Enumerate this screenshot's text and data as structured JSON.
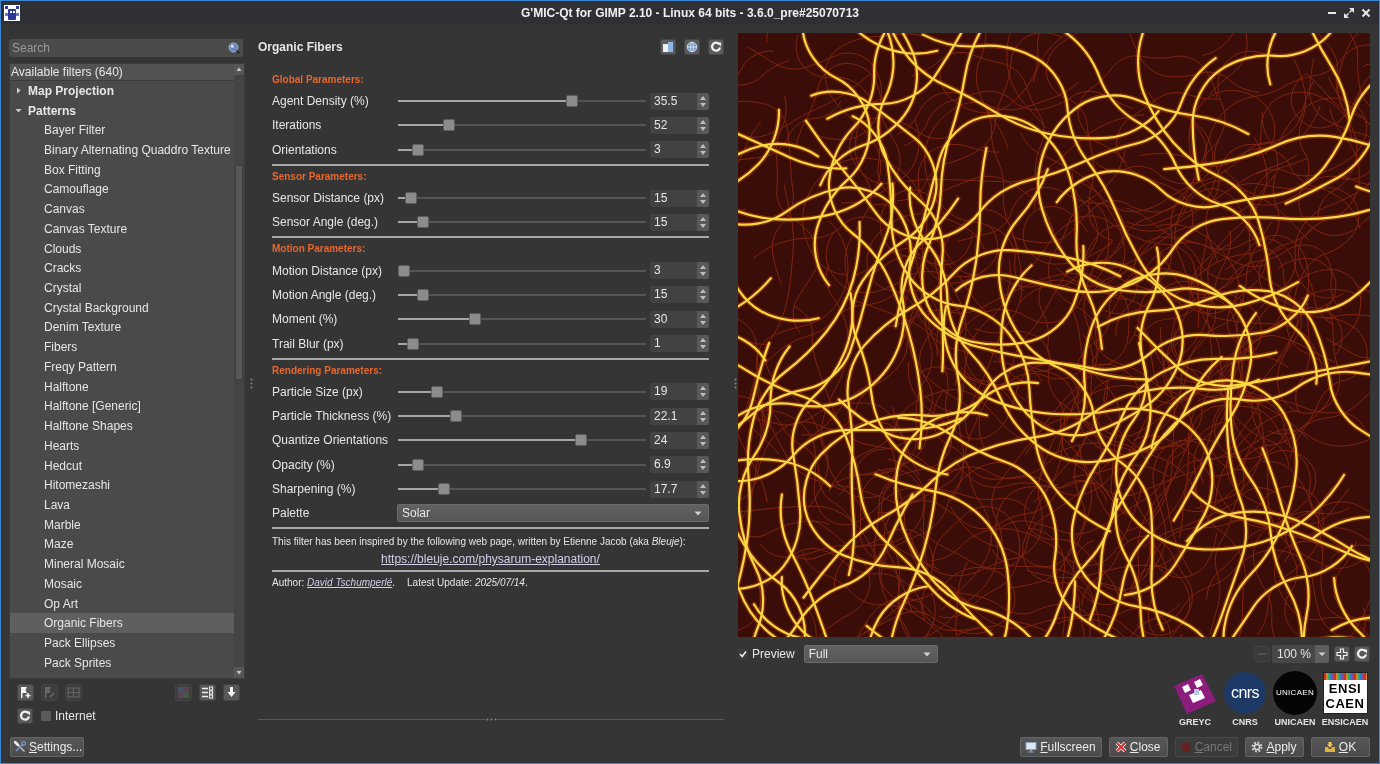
{
  "window": {
    "title": "G'MIC-Qt for GIMP 2.10 - Linux 64 bits - 3.6.0_pre#25070713"
  },
  "filters": {
    "search": {
      "placeholder": "Search"
    },
    "header": "Available filters (640)",
    "tree": [
      {
        "label": "Map Projection",
        "expanded": false,
        "selected": false
      },
      {
        "label": "Patterns",
        "expanded": true,
        "selected": false,
        "children": [
          {
            "label": "Bayer Filter",
            "selected": false
          },
          {
            "label": "Binary Alternating Quaddro Texture",
            "selected": false
          },
          {
            "label": "Box Fitting",
            "selected": false
          },
          {
            "label": "Camouflage",
            "selected": false
          },
          {
            "label": "Canvas",
            "selected": false
          },
          {
            "label": "Canvas Texture",
            "selected": false
          },
          {
            "label": "Clouds",
            "selected": false
          },
          {
            "label": "Cracks",
            "selected": false
          },
          {
            "label": "Crystal",
            "selected": false
          },
          {
            "label": "Crystal Background",
            "selected": false
          },
          {
            "label": "Denim Texture",
            "selected": false
          },
          {
            "label": "Fibers",
            "selected": false
          },
          {
            "label": "Freqy Pattern",
            "selected": false
          },
          {
            "label": "Halftone",
            "selected": false
          },
          {
            "label": "Halftone [Generic]",
            "selected": false
          },
          {
            "label": "Halftone Shapes",
            "selected": false
          },
          {
            "label": "Hearts",
            "selected": false
          },
          {
            "label": "Hedcut",
            "selected": false
          },
          {
            "label": "Hitomezashi",
            "selected": false
          },
          {
            "label": "Lava",
            "selected": false
          },
          {
            "label": "Marble",
            "selected": false
          },
          {
            "label": "Maze",
            "selected": false
          },
          {
            "label": "Mineral Mosaic",
            "selected": false
          },
          {
            "label": "Mosaic",
            "selected": false
          },
          {
            "label": "Op Art",
            "selected": false
          },
          {
            "label": "Organic Fibers",
            "selected": true
          },
          {
            "label": "Pack Ellipses",
            "selected": false
          },
          {
            "label": "Pack Sprites",
            "selected": false
          }
        ]
      }
    ]
  },
  "filter_toolbar": [
    {
      "kind": "fave-add",
      "disabled": false
    },
    {
      "kind": "fave-rename",
      "disabled": true
    },
    {
      "kind": "fave-remove",
      "disabled": true
    },
    {
      "kind": "colors",
      "disabled": true
    },
    {
      "kind": "visibility",
      "disabled": false
    },
    {
      "kind": "import",
      "disabled": false
    }
  ],
  "internet": {
    "label": "Internet",
    "checked": false
  },
  "settings_button": {
    "label": "Settings..."
  },
  "filter": {
    "title": "Organic Fibers",
    "sections": [
      {
        "title": "Global Parameters:",
        "params": [
          {
            "label": "Agent Density (%)",
            "level": 0.71,
            "value": "35.5"
          },
          {
            "label": "Iterations",
            "level": 0.19,
            "value": "52"
          },
          {
            "label": "Orientations",
            "level": 0.06,
            "value": "3"
          }
        ]
      },
      {
        "title": "Sensor Parameters:",
        "params": [
          {
            "label": "Sensor Distance (px)",
            "level": 0.03,
            "value": "15"
          },
          {
            "label": "Sensor Angle (deg.)",
            "level": 0.08,
            "value": "15"
          }
        ]
      },
      {
        "title": "Motion Parameters:",
        "params": [
          {
            "label": "Motion Distance (px)",
            "level": 0,
            "value": "3"
          },
          {
            "label": "Motion Angle (deg.)",
            "level": 0.08,
            "value": "15"
          },
          {
            "label": "Moment (%)",
            "level": 0.3,
            "value": "30"
          },
          {
            "label": "Trail Blur (px)",
            "level": 0.04,
            "value": "1"
          }
        ]
      },
      {
        "title": "Rendering Parameters:",
        "params": [
          {
            "label": "Particle Size (px)",
            "level": 0.14,
            "value": "19"
          },
          {
            "label": "Particle Thickness (%)",
            "level": 0.22,
            "value": "22.1"
          },
          {
            "label": "Quantize Orientations",
            "level": 0.75,
            "value": "24"
          },
          {
            "label": "Opacity (%)",
            "level": 0.06,
            "value": "6.9"
          },
          {
            "label": "Sharpening (%)",
            "level": 0.17,
            "value": "17.7"
          }
        ]
      }
    ],
    "palette": {
      "label": "Palette",
      "value": "Solar"
    },
    "note": "This filter has been inspired by the following web page, written by Etienne Jacob (aka *Bleuje*):",
    "link": "https://bleuje.com/physarum-explanation/",
    "author": {
      "prefix": "Author:",
      "name": "David Tschumperlé",
      "suffix": "."
    },
    "update": "Latest Update: *2025/07/14*."
  },
  "preview": {
    "checked": true,
    "label": "Preview",
    "mode": "Full",
    "zoom": "100 %",
    "zoom_out": {
      "disabled": true
    }
  },
  "logos": [
    {
      "kind": "greyc",
      "label": "GREYC"
    },
    {
      "kind": "cnrs",
      "mark": [
        "cnrs"
      ],
      "label": "CNRS"
    },
    {
      "kind": "unicaen",
      "mark": [
        "UNICAEN"
      ],
      "label": "UNICAEN"
    },
    {
      "kind": "ensicaen",
      "mark": [
        "ENSI",
        "CAEN"
      ],
      "label": "ENSICAEN"
    }
  ],
  "buttons": [
    {
      "kind": "fullscreen",
      "label": "Fullscreen",
      "disabled": false
    },
    {
      "kind": "close",
      "label": "Close",
      "disabled": false
    },
    {
      "kind": "cancel",
      "label": "Cancel",
      "disabled": true
    },
    {
      "kind": "apply",
      "label": "Apply",
      "disabled": false
    },
    {
      "kind": "ok",
      "label": "OK",
      "disabled": false
    }
  ]
}
